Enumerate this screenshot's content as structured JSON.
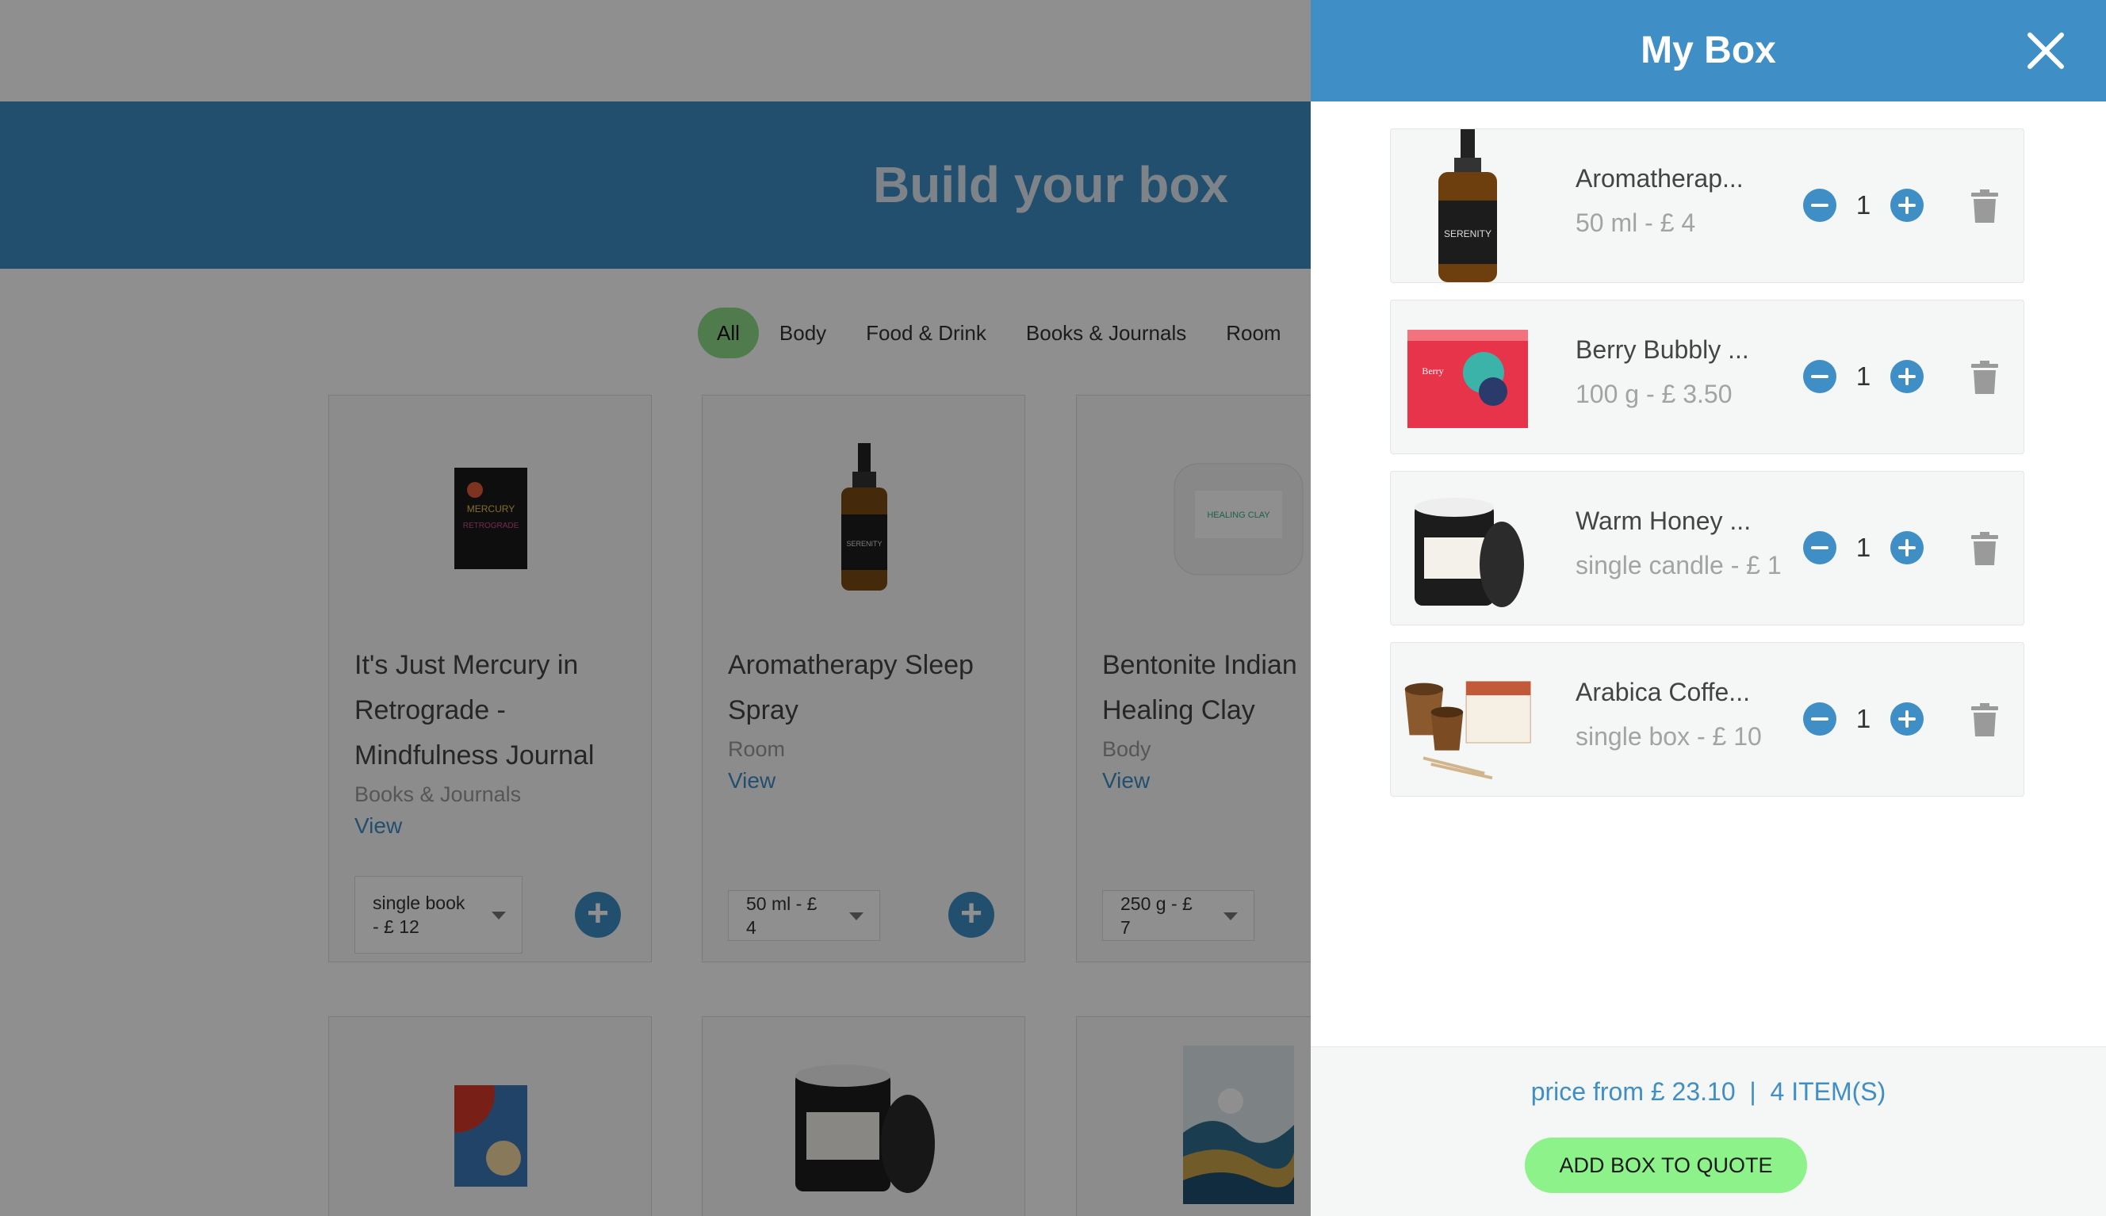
{
  "page": {
    "hero_title": "Build your box",
    "filters": [
      "All",
      "Body",
      "Food & Drink",
      "Books & Journals",
      "Room"
    ],
    "active_filter": "All",
    "products": [
      {
        "name": "It's Just Mercury in Retrograde - Mindfulness Journal",
        "category": "Books & Journals",
        "view_label": "View",
        "variant": "single book - £ 12"
      },
      {
        "name": "Aromatherapy Sleep Spray",
        "category": "Room",
        "view_label": "View",
        "variant": "50 ml - £ 4"
      },
      {
        "name": "Bentonite Indian Healing Clay",
        "category": "Body",
        "view_label": "View",
        "variant": "250 g - £ 7"
      }
    ]
  },
  "drawer": {
    "title": "My Box",
    "items": [
      {
        "name": "Aromatherap...",
        "variant": "50 ml - £ 4",
        "qty": "1"
      },
      {
        "name": "Berry Bubbly ...",
        "variant": "100 g - £ 3.50",
        "qty": "1"
      },
      {
        "name": "Warm Honey ...",
        "variant": "single candle - £ 1",
        "qty": "1"
      },
      {
        "name": "Arabica Coffe...",
        "variant": "single box - £ 10",
        "qty": "1"
      }
    ],
    "summary": "price from £ 23.10  |  4 ITEM(S)",
    "quote_button": "ADD BOX TO QUOTE"
  },
  "icons": {
    "close": "close-icon",
    "minus": "minus-circle-icon",
    "plus": "plus-circle-icon",
    "trash": "trash-icon",
    "add": "add-circle-icon"
  },
  "colors": {
    "primary": "#3f8ec6",
    "accent_green": "#8ef28a",
    "muted_text": "#a3a3a3"
  }
}
